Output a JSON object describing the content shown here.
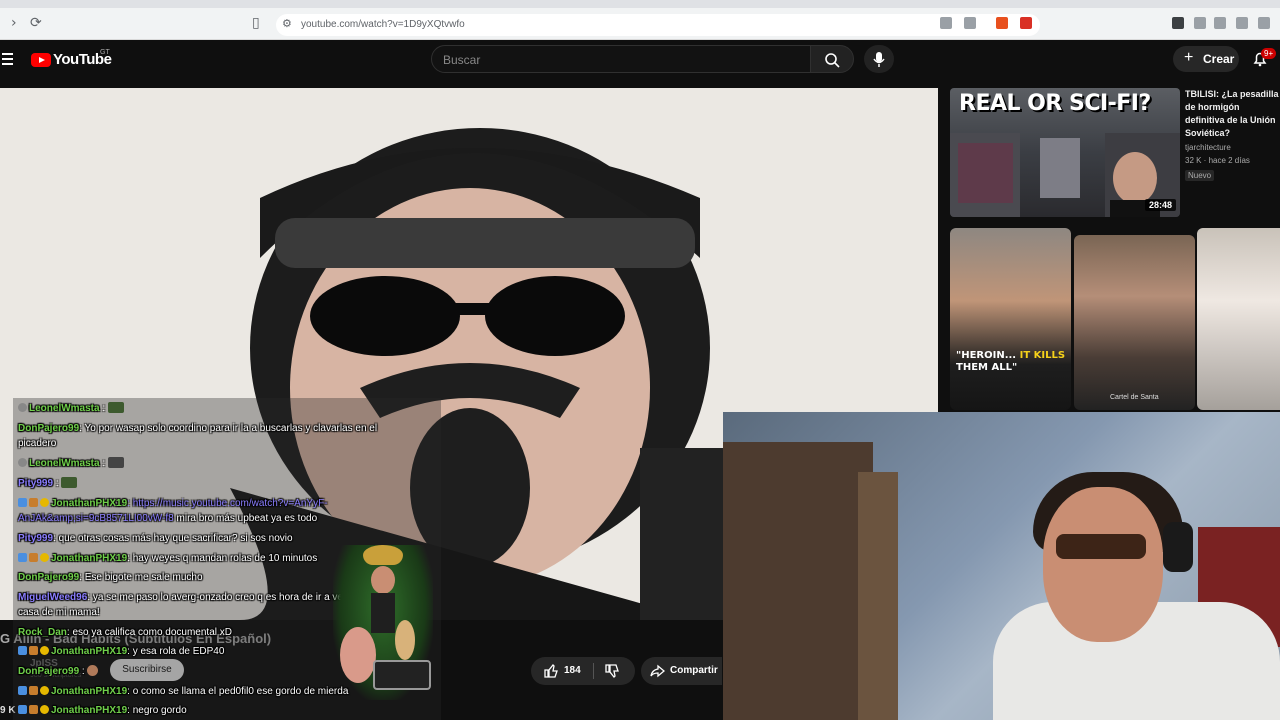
{
  "browser": {
    "url": "youtube.com/watch?v=1D9yXQtvwfo"
  },
  "header": {
    "logo_text": "YouTube",
    "country": "GT",
    "search_placeholder": "Buscar",
    "create_label": "Crear",
    "notifications_badge": "9+"
  },
  "recommended": {
    "thumb_text": "REAL OR SCI-FI?",
    "duration": "28:48",
    "title": "TBILISI: ¿La pesadilla de hormigón definitiva de la Unión Soviética?",
    "channel": "tjarchitecture",
    "meta": "32 K · hace 2 días",
    "badge": "Nuevo"
  },
  "shorts": [
    {
      "caption_line1": "\"HEROIN...",
      "caption_highlight": "IT KILLS",
      "caption_line2": "THEM ALL\""
    },
    {
      "caption": "Cartel de Santa"
    }
  ],
  "video": {
    "title_overlay": "G Allin - Bad Habits (Subtitulos En Español)",
    "channel_overlay": "JpISS",
    "subscribers_overlay": "980 suscriptores",
    "subscribe_label": "Suscribirse",
    "likes": "184",
    "share_label": "Compartir",
    "views_fragment": "9 K"
  },
  "chat": [
    {
      "user": "LeonelWmasta",
      "text": "",
      "color": "#6fcf4a",
      "top": 0
    },
    {
      "user": "DonPajero99",
      "text": ": Yo por wasap solo coordino para ir la a buscarlas y clavarlas en el",
      "text2": "picadero",
      "color": "#6fcf4a"
    },
    {
      "user": "LeonelWmasta",
      "text": "",
      "color": "#6fcf4a"
    },
    {
      "user": "Pity999",
      "text": ":",
      "color": "#8a7dff"
    },
    {
      "user": "JonathanPHX19",
      "text": ": https://music.youtube.com/watch?v=AnYyF-",
      "text2_link": "AnJAk&amp;si=9cB8571LI00vW-f8",
      "text2": " mira bro más upbeat ya es todo",
      "color": "#6fcf4a"
    },
    {
      "user": "Pity999",
      "text": ": que otras cosas más hay que sacrificar? si sos novio",
      "color": "#8a7dff"
    },
    {
      "user": "JonathanPHX19",
      "text": ": hay weyes q mandan rolas de 10 minutos",
      "color": "#6fcf4a"
    },
    {
      "user": "DonPajero99",
      "text": ": Ese bigote me sale mucho",
      "color": "#6fcf4a"
    },
    {
      "user": "MiguelWeed96",
      "text": ": ya se me paso lo averg-onzado creo q es hora de ir a ver tu stream en",
      "text2": "casa de mi mama!",
      "color": "#8a7dff"
    },
    {
      "user": "Rock_Dan",
      "text": ": eso ya califica como documental xD",
      "color": "#6fcf4a"
    },
    {
      "user": "JonathanPHX19",
      "text": ": y esa rola de EDP40",
      "color": "#6fcf4a"
    },
    {
      "user": "DonPajero99",
      "text": ":",
      "color": "#6fcf4a"
    },
    {
      "user": "JonathanPHX19",
      "text": ": o como se llama el ped0fil0 ese gordo de mierda",
      "color": "#6fcf4a"
    },
    {
      "user": "JonathanPHX19",
      "text": ": negro gordo",
      "color": "#6fcf4a"
    }
  ]
}
